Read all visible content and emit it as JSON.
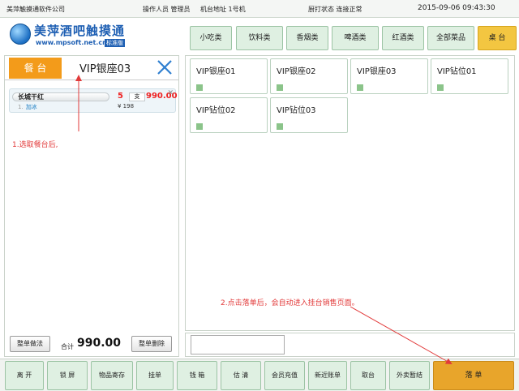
{
  "status": {
    "company": "美萍触摸通软件公司",
    "operator": "操作人员 管理员",
    "address": "机台地址 1号机",
    "printer": "厨打状态 连接正常",
    "datetime": "2015-09-06 09:43:30"
  },
  "logo": {
    "name": "美萍酒吧触摸通",
    "url": "www.mpsoft.net.cn",
    "badge": "标准版"
  },
  "category_tabs": [
    {
      "label": "小吃类"
    },
    {
      "label": "饮料类"
    },
    {
      "label": "香烟类"
    },
    {
      "label": "啤酒类"
    },
    {
      "label": "红酒类"
    },
    {
      "label": "全部菜品"
    },
    {
      "label": "桌 台"
    }
  ],
  "left": {
    "table_label": "餐 台",
    "table_name": "VIP银座03",
    "order": {
      "name": "长城干红",
      "index": "1.",
      "note": "加冰",
      "qty": "5",
      "unit": "支",
      "price": "990.00",
      "unit_price": "¥ 198",
      "remove": "✕"
    },
    "annotation": "1.选取餐台后,",
    "whole_method": "整单做法",
    "total_label": "合计",
    "total_value": "990.00",
    "whole_delete": "整单删除"
  },
  "tables": [
    {
      "name": "VIP银座01"
    },
    {
      "name": "VIP银座02"
    },
    {
      "name": "VIP银座03"
    },
    {
      "name": "VIP钻位01"
    },
    {
      "name": "VIP钻位02"
    },
    {
      "name": "VIP钻位03"
    }
  ],
  "annotation2": "2.点击落单后，会自动进入挂台销售页面。",
  "bottom": [
    {
      "label": "离 开"
    },
    {
      "label": "锁 屏"
    },
    {
      "label": "物品寄存"
    },
    {
      "label": "挂单"
    },
    {
      "label": "钱 箱"
    },
    {
      "label": "估 清"
    },
    {
      "label": "会员充值"
    },
    {
      "label": "新近账单"
    },
    {
      "label": "取台"
    },
    {
      "label": "外卖暂结"
    },
    {
      "label": "落 单"
    }
  ],
  "colors": {
    "accent_orange": "#f39b1a",
    "annotation_red": "#e23a3a",
    "tab_green": "#dff0e2",
    "active_yellow": "#f3c641",
    "primary_button": "#e8a52b"
  }
}
